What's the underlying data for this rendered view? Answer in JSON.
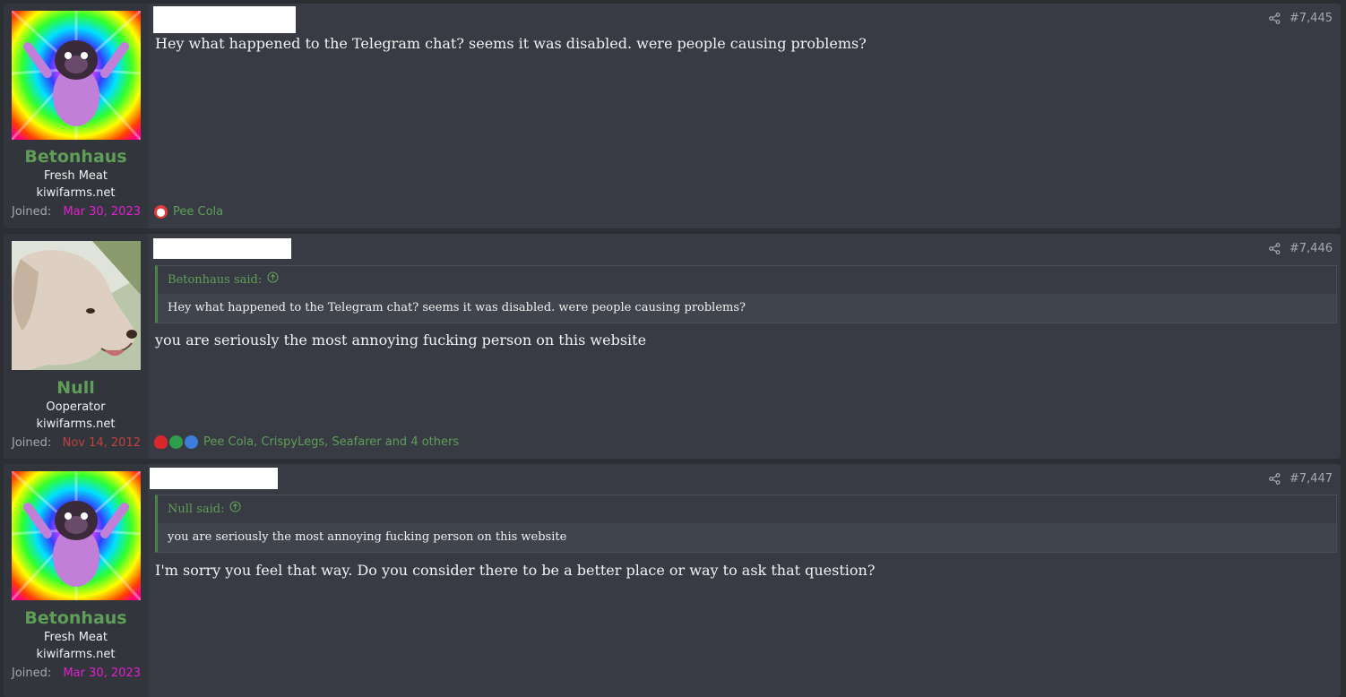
{
  "posts": [
    {
      "username": "Betonhaus",
      "user_title": "Fresh Meat",
      "user_banner": "kiwifarms.net",
      "joined_label": "Joined:",
      "joined_date": "Mar 30, 2023",
      "joined_date_color": "#e020d0",
      "post_number": "#7,445",
      "message": "Hey what happened to the Telegram chat? seems it was disabled. were people causing problems?",
      "reactions_text": "Pee Cola",
      "reaction_icons": [
        "clock-reaction-icon"
      ]
    },
    {
      "username": "Null",
      "user_title": "Ooperator",
      "user_banner": "kiwifarms.net",
      "joined_label": "Joined:",
      "joined_date": "Nov 14, 2012",
      "joined_date_color": "#c0423f",
      "post_number": "#7,446",
      "quote_author": "Betonhaus said:",
      "quote_text": "Hey what happened to the Telegram chat? seems it was disabled. were people causing problems?",
      "message": "you are seriously the most annoying fucking person on this website",
      "reactions_text": "Pee Cola, CrispyLegs, Seafarer and 4 others",
      "reaction_icons": [
        "heart-reaction-icon",
        "check-reaction-icon",
        "like-reaction-icon"
      ]
    },
    {
      "username": "Betonhaus",
      "user_title": "Fresh Meat",
      "user_banner": "kiwifarms.net",
      "joined_label": "Joined:",
      "joined_date": "Mar 30, 2023",
      "joined_date_color": "#e020d0",
      "post_number": "#7,447",
      "quote_author": "Null said:",
      "quote_text": "you are seriously the most annoying fucking person on this website",
      "message": "I'm sorry you feel that way. Do you consider there to be a better place or way to ask that question?"
    }
  ],
  "colors": {
    "accent_green": "#5f9e57",
    "post_bg": "#383b44",
    "sidebar_bg": "#32353c"
  }
}
